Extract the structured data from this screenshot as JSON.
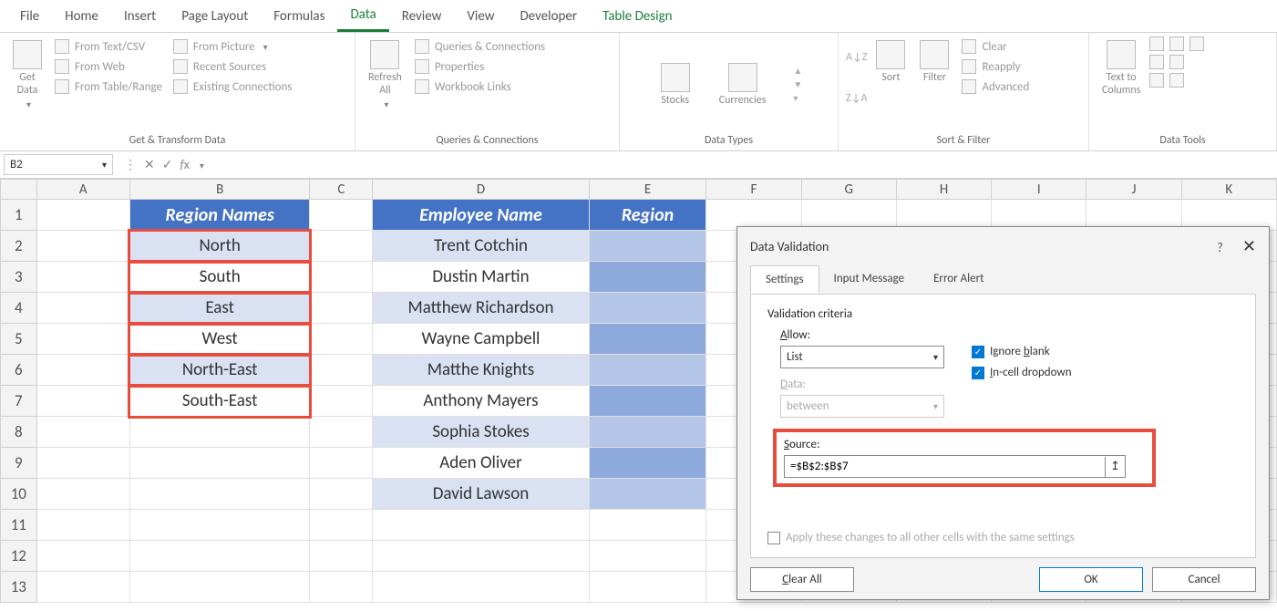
{
  "tabs": {
    "items": [
      "File",
      "Home",
      "Insert",
      "Page Layout",
      "Formulas",
      "Data",
      "Review",
      "View",
      "Developer"
    ],
    "active": 5,
    "contextual": "Table Design"
  },
  "ribbon": {
    "groups": [
      {
        "name": "Get & Transform Data",
        "big": "Get\nData",
        "items": [
          "From Text/CSV",
          "From Web",
          "From Table/Range",
          "From Picture",
          "Recent Sources",
          "Existing Connections"
        ]
      },
      {
        "name": "Queries & Connections",
        "big": "Refresh\nAll",
        "items": [
          "Queries & Connections",
          "Properties",
          "Workbook Links"
        ]
      },
      {
        "name": "Data Types",
        "items": [
          "Stocks",
          "Currencies"
        ]
      },
      {
        "name": "Sort & Filter",
        "items": [
          "Sort",
          "Filter",
          "Clear",
          "Reapply",
          "Advanced"
        ]
      },
      {
        "name": "Data Tools",
        "big": "Text to\nColumns"
      }
    ]
  },
  "namebox": "B2",
  "cols": [
    "A",
    "B",
    "C",
    "D",
    "E",
    "F",
    "G",
    "H",
    "I",
    "J",
    "K"
  ],
  "table": {
    "b_header": "Region Names",
    "d_header": "Employee Name",
    "e_header": "Region",
    "regions": [
      "North",
      "South",
      "East",
      "West",
      "North-East",
      "South-East"
    ],
    "employees": [
      "Trent Cotchin",
      "Dustin Martin",
      "Matthew Richardson",
      "Wayne Campbell",
      "Matthe Knights",
      "Anthony Mayers",
      "Sophia Stokes",
      "Aden Oliver",
      "David Lawson"
    ]
  },
  "dialog": {
    "title": "Data Validation",
    "tabs": [
      "Settings",
      "Input Message",
      "Error Alert"
    ],
    "criteria_label": "Validation criteria",
    "allow_label": "Allow:",
    "allow_value": "List",
    "data_label": "Data:",
    "data_value": "between",
    "ignore_blank": "Ignore blank",
    "incell": "In-cell dropdown",
    "source_label": "Source:",
    "source_value": "=$B$2:$B$7",
    "apply": "Apply these changes to all other cells with the same settings",
    "clear": "Clear All",
    "ok": "OK",
    "cancel": "Cancel"
  }
}
